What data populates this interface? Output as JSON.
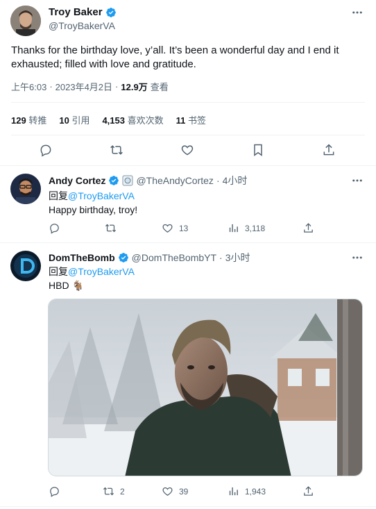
{
  "main_tweet": {
    "author_name": "Troy Baker",
    "author_handle": "@TroyBakerVA",
    "text": "Thanks for the birthday love, y’all. It’s been a wonderful day and I end it exhausted; filled with love and gratitude.",
    "time": "上午6:03",
    "date": "2023年4月2日",
    "views_count": "12.9万",
    "views_label": "查看",
    "stats": {
      "retweets_count": "129",
      "retweets_label": "转推",
      "quotes_count": "10",
      "quotes_label": "引用",
      "likes_count": "4,153",
      "likes_label": "喜欢次数",
      "bookmarks_count": "11",
      "bookmarks_label": "书签"
    },
    "icons": [
      "reply-icon",
      "retweet-icon",
      "like-icon",
      "bookmark-icon",
      "share-icon"
    ]
  },
  "replies": [
    {
      "author_name": "Andy Cortez",
      "author_handle": "@TheAndyCortez",
      "time_ago": "4小时",
      "reply_prefix": "回复",
      "reply_to": "@TroyBakerVA",
      "text": "Happy birthday, troy!",
      "retweets": "",
      "likes": "13",
      "views": "3,118"
    },
    {
      "author_name": "DomTheBomb",
      "author_handle": "@DomTheBombYT",
      "time_ago": "3小时",
      "reply_prefix": "回复",
      "reply_to": "@TroyBakerVA",
      "text": "HBD 🐐",
      "retweets": "2",
      "likes": "39",
      "views": "1,943"
    }
  ],
  "separators": {
    "dot": "·"
  },
  "colors": {
    "accent": "#1d9bf0",
    "text": "#0f1419",
    "secondary": "#536471",
    "divider": "#eff3f4"
  }
}
